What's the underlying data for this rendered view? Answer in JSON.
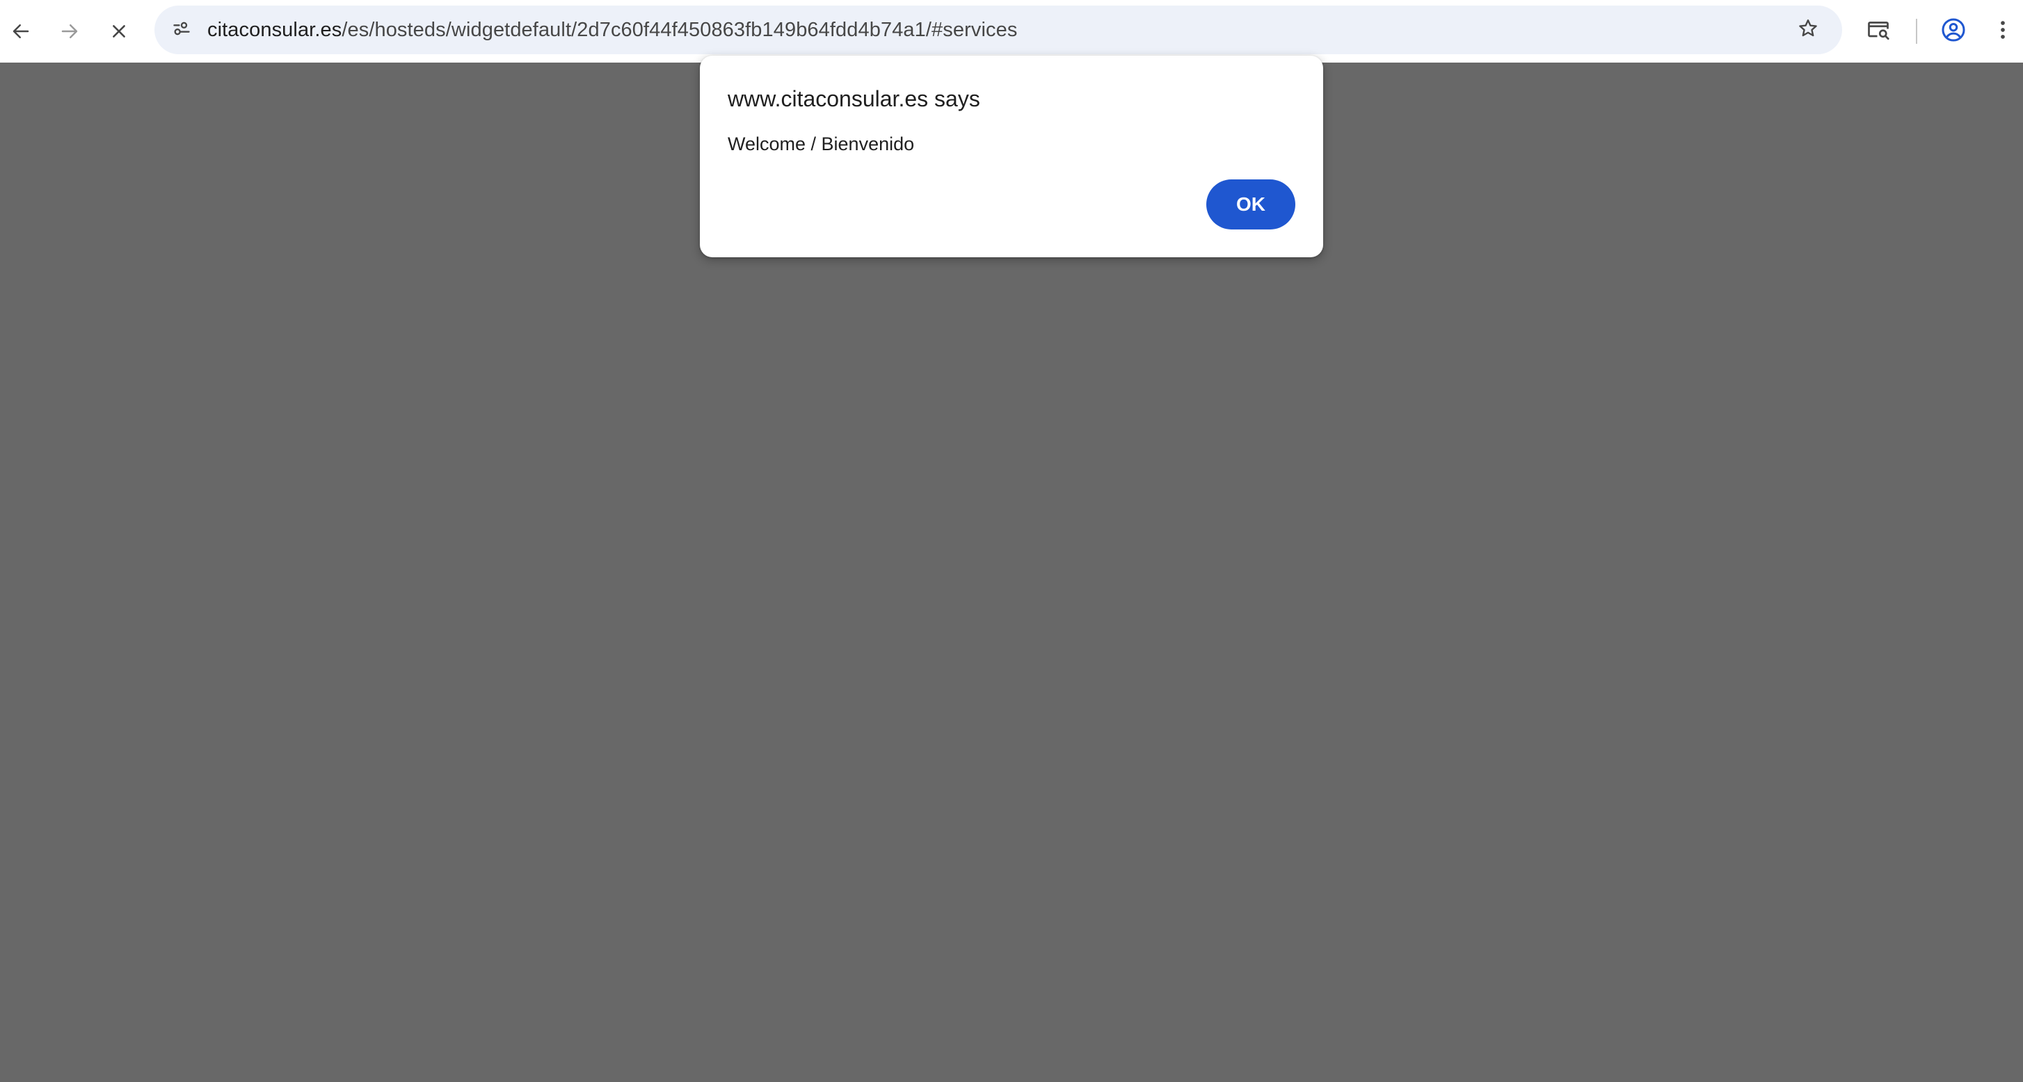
{
  "browser": {
    "url_host": "citaconsular.es",
    "url_path": "/es/hosteds/widgetdefault/2d7c60f44f450863fb149b64fdd4b74a1/#services",
    "nav": {
      "back_icon": "arrow-left",
      "forward_icon": "arrow-right",
      "stop_icon": "close-x"
    },
    "omnibox_icons": {
      "site_info": "tune-sliders",
      "bookmark": "star-outline"
    },
    "right_icons": {
      "search_tab": "screen-search",
      "profile": "account-circle",
      "menu": "more-vertical"
    },
    "colors": {
      "toolbar_bg": "#ffffff",
      "omnibox_bg": "#edf1f9",
      "scrim": "#686868"
    }
  },
  "dialog": {
    "title": "www.citaconsular.es says",
    "message": "Welcome / Bienvenido",
    "ok_label": "OK",
    "ok_color": "#1f57d0"
  }
}
